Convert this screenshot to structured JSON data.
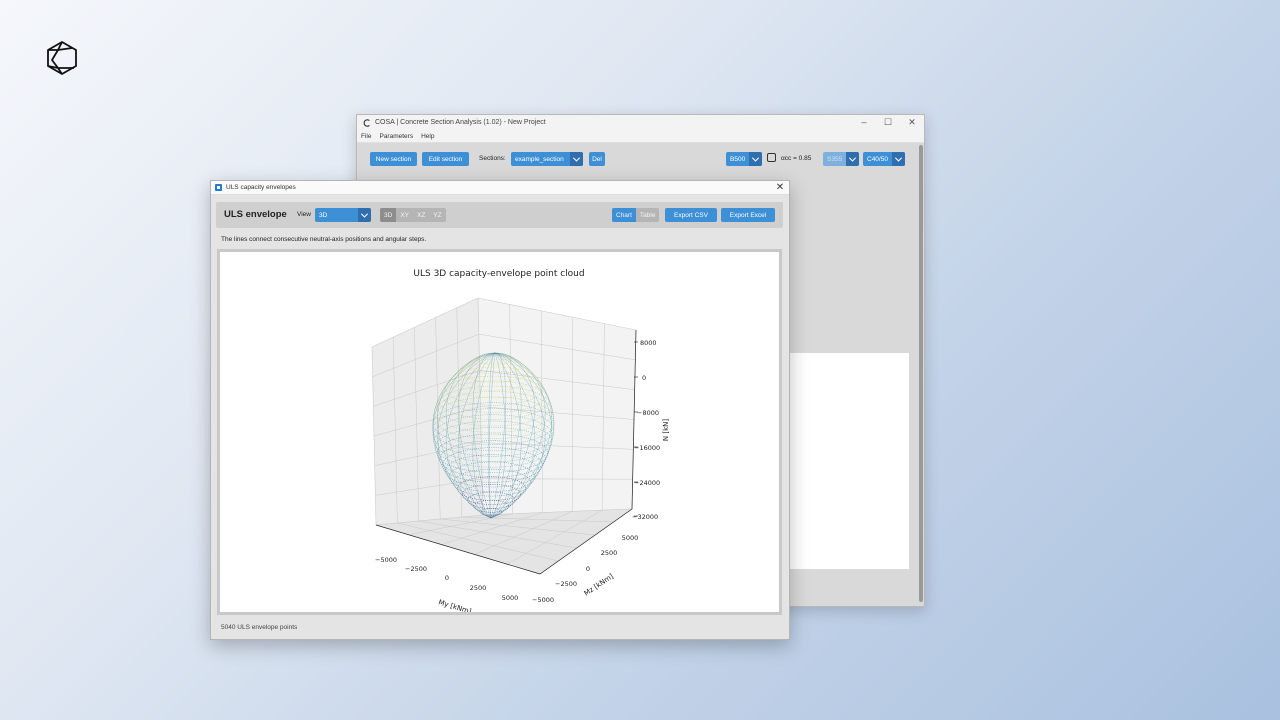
{
  "main_window": {
    "title": "COSA | Concrete Section Analysis (1.02) - New Project",
    "menu": [
      "File",
      "Parameters",
      "Help"
    ],
    "toolbar": {
      "new_section": "New section",
      "edit_section": "Edit section",
      "sections_label": "Sections:",
      "section_selected": "example_section",
      "del": "Del",
      "rebar_grade": "B500",
      "alpha_cc_label": "αcc = 0.85",
      "steel_grade": "S355",
      "concrete_grade": "C40/50"
    }
  },
  "dialog": {
    "title": "ULS capacity envelopes",
    "heading": "ULS envelope",
    "view_label": "View",
    "view_selected": "3D",
    "view_buttons": [
      "3D",
      "XY",
      "XZ",
      "YZ"
    ],
    "mode_buttons": [
      "Chart",
      "Table"
    ],
    "export_csv": "Export CSV",
    "export_excel": "Export Excel",
    "info": "The lines connect consecutive neutral-axis positions and angular steps.",
    "status": "5040 ULS envelope points"
  },
  "chart_data": {
    "type": "scatter",
    "title": "ULS 3D capacity-envelope point cloud",
    "xlabel": "My [kNm]",
    "ylabel": "Mz [kNm]",
    "zlabel": "N [kN]",
    "x_ticks": [
      "−5000",
      "−2500",
      "0",
      "2500",
      "5000"
    ],
    "y_ticks": [
      "−5000",
      "−2500",
      "0",
      "2500",
      "5000"
    ],
    "z_ticks": [
      "8000",
      "0",
      "−8000",
      "−16000",
      "−24000",
      "−32000"
    ],
    "xlim": [
      -6000,
      6000
    ],
    "ylim": [
      -6000,
      6000
    ],
    "zlim": [
      -33000,
      9000
    ],
    "n_points": 5040,
    "shape": "closed ellipsoidal envelope, apex at N≈8000 kN, bottom at N≈−32000 kN, max |M|≈4500 kNm",
    "colormap": [
      "#2e3f7f",
      "#3a8fa0",
      "#62b5a8",
      "#a6cf6a",
      "#d9e34a"
    ]
  }
}
